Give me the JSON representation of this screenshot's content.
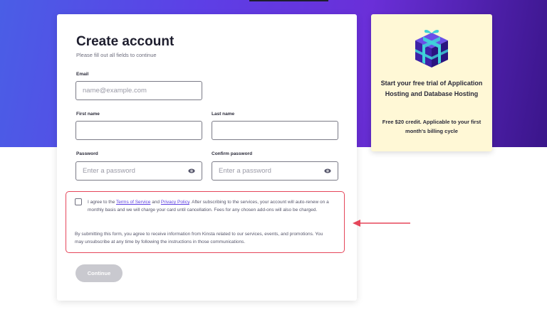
{
  "form": {
    "title": "Create account",
    "subtitle": "Please fill out all fields to continue",
    "email": {
      "label": "Email",
      "placeholder": "name@example.com",
      "value": ""
    },
    "first_name": {
      "label": "First name",
      "value": ""
    },
    "last_name": {
      "label": "Last name",
      "value": ""
    },
    "password": {
      "label": "Password",
      "placeholder": "Enter a password",
      "icon": "eye-icon"
    },
    "confirm_password": {
      "label": "Confirm password",
      "placeholder": "Enter a password",
      "icon": "eye-icon"
    },
    "consent": {
      "checked": false,
      "prefix": "I agree to the ",
      "terms_link": "Terms of Service",
      "and": " and ",
      "privacy_link": "Privacy Policy",
      "suffix": ". After subscribing to the services, your account will auto-renew on a monthly basis and we will charge your card until cancellation. Fees for any chosen add-ons will also be charged.",
      "marketing": "By submitting this form, you agree to receive information from Kinsta related to our services, events, and promotions. You may unsubscribe at any time by following the instructions in those communications."
    },
    "continue_label": "Continue"
  },
  "promo": {
    "icon": "gift-box-icon",
    "title": "Start your free trial of Application Hosting and Database Hosting",
    "text": "Free $20 credit. Applicable to your first month's billing cycle"
  },
  "colors": {
    "accent": "#5b3ee0",
    "highlight": "#e5465a",
    "promo_bg": "#fff8d6",
    "button_disabled": "#c9c9cf"
  }
}
